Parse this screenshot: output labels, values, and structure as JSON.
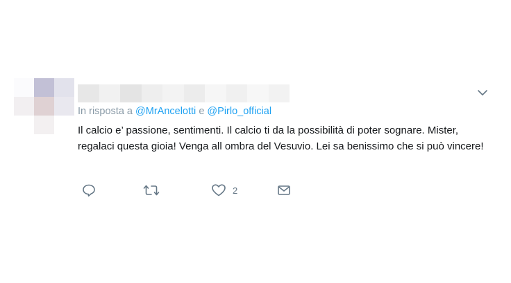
{
  "tweet": {
    "reply_prefix": "In risposta a",
    "mention_1": "@MrAncelotti",
    "conjunction": "e",
    "mention_2": "@Pirlo_official",
    "text": "Il calcio e’ passione, sentimenti. Il calcio ti da la possibilità di poter sognare. Mister, regalaci questa gioia! Venga all ombra del Vesuvio. Lei sa benissimo che si può vincere!"
  },
  "actions": {
    "like_count": "2"
  },
  "icons": {
    "menu": "chevron-down-icon",
    "reply": "speech-bubble-icon",
    "retweet": "retweet-arrows-icon",
    "like": "heart-icon",
    "dm": "envelope-icon"
  },
  "colors": {
    "mention": "#1da1f2",
    "secondary_text": "#8899a6",
    "icon": "#657786",
    "text": "#14171a"
  }
}
